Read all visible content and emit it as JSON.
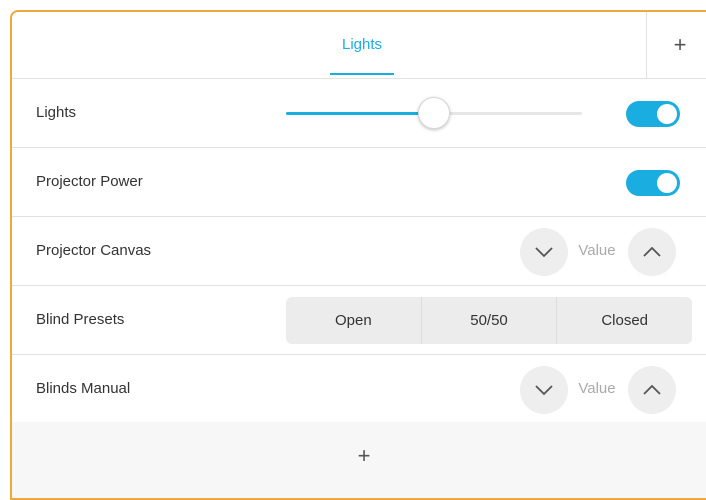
{
  "header": {
    "tabs": [
      {
        "label": "Lights",
        "active": true
      }
    ],
    "add_tab_label": "+"
  },
  "rows": [
    {
      "label": "Lights",
      "control": "slider",
      "value_percent": 50,
      "toggle_on": true
    },
    {
      "label": "Projector Power",
      "control": "toggle",
      "toggle_on": true
    },
    {
      "label": "Projector Canvas",
      "control": "stepper",
      "value": "Value"
    },
    {
      "label": "Blind Presets",
      "control": "segmented",
      "options": [
        "Open",
        "50/50",
        "Closed"
      ]
    },
    {
      "label": "Blinds Manual",
      "control": "stepper",
      "value": "Value"
    }
  ],
  "footer": {
    "add_label": "+"
  },
  "colors": {
    "accent": "#1aaee0",
    "panel_border": "#f0a83c",
    "stepper_bg": "#eeeeee",
    "segment_bg": "#ececec"
  }
}
